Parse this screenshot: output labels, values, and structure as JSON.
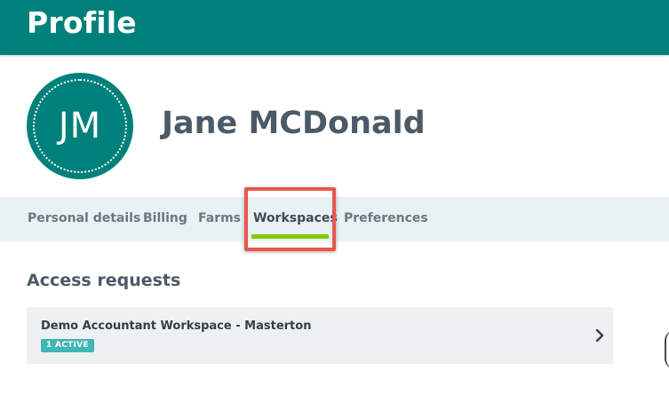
{
  "header": {
    "title": "Profile"
  },
  "profile": {
    "initials": "JM",
    "name": "Jane MCDonald"
  },
  "tabs": [
    {
      "label": "Personal details"
    },
    {
      "label": "Billing"
    },
    {
      "label": "Farms"
    },
    {
      "label": "Workspaces",
      "active": true
    },
    {
      "label": "Preferences"
    }
  ],
  "access_requests": {
    "section_title": "Access requests",
    "items": [
      {
        "title": "Demo Accountant Workspace - Masterton",
        "status": "1 ACTIVE"
      }
    ]
  },
  "colors": {
    "brand": "#00807a",
    "active_tab_indicator": "#86c800",
    "highlight": "#e8574b",
    "badge": "#3fb7b5"
  }
}
